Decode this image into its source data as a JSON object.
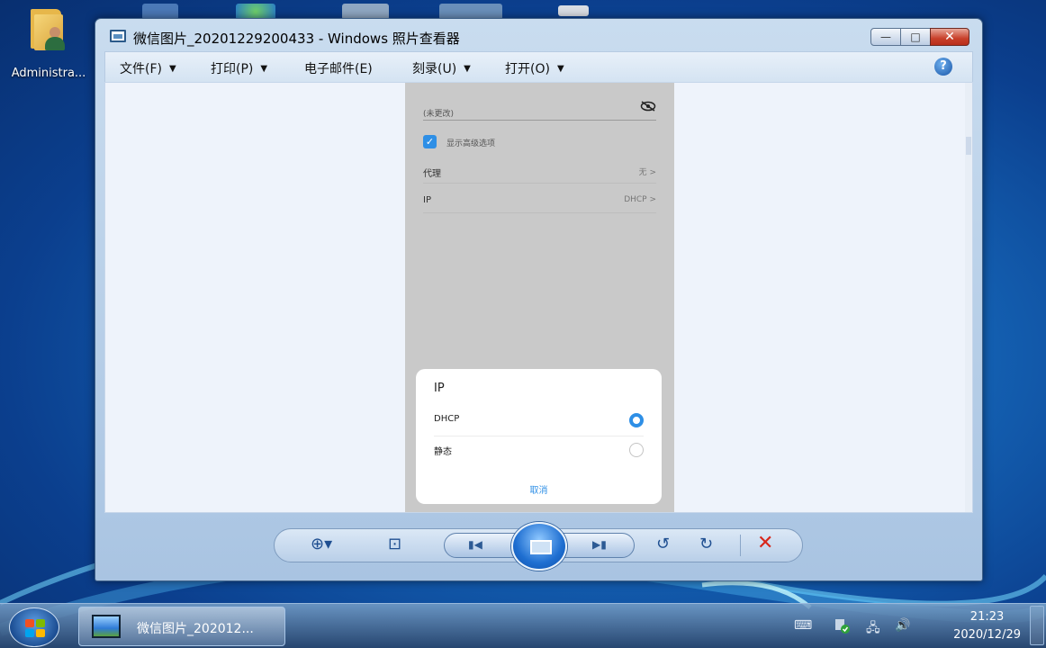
{
  "desktop": {
    "icon_label": "Administra..."
  },
  "window": {
    "title": "微信图片_20201229200433 - Windows 照片查看器",
    "min_glyph": "—",
    "max_glyph": "□",
    "close_glyph": "✕"
  },
  "menu": {
    "items": [
      {
        "label": "文件(F)",
        "arrow": "▼"
      },
      {
        "label": "打印(P)",
        "arrow": "▼"
      },
      {
        "label": "电子邮件(E)",
        "arrow": ""
      },
      {
        "label": "刻录(U)",
        "arrow": "▼"
      },
      {
        "label": "打开(O)",
        "arrow": "▼"
      }
    ],
    "help_glyph": "?"
  },
  "photo": {
    "password_placeholder": "(未更改)",
    "checkbox_label": "显示高级选项",
    "checkbox_glyph": "✓",
    "rows": [
      {
        "key": "代理",
        "value": "无 >"
      },
      {
        "key": "IP",
        "value": "DHCP >"
      }
    ],
    "dialog": {
      "title": "IP",
      "options": [
        {
          "label": "DHCP",
          "selected": true
        },
        {
          "label": "静态",
          "selected": false
        }
      ],
      "cancel": "取消"
    }
  },
  "controls": {
    "zoom": "⊕▾",
    "fit": "⊡",
    "prev": "▮◀",
    "next": "▶▮",
    "rotate_left": "↺",
    "rotate_right": "↻",
    "delete": "✕"
  },
  "taskbar": {
    "task_label": "微信图片_202012...",
    "tray": {
      "keyboard": "⌨",
      "network": "🖧",
      "volume": "🔊"
    },
    "time": "21:23",
    "date": "2020/12/29"
  },
  "colors": {
    "accent_blue": "#2e8fe6",
    "delete_red": "#d8261a"
  }
}
